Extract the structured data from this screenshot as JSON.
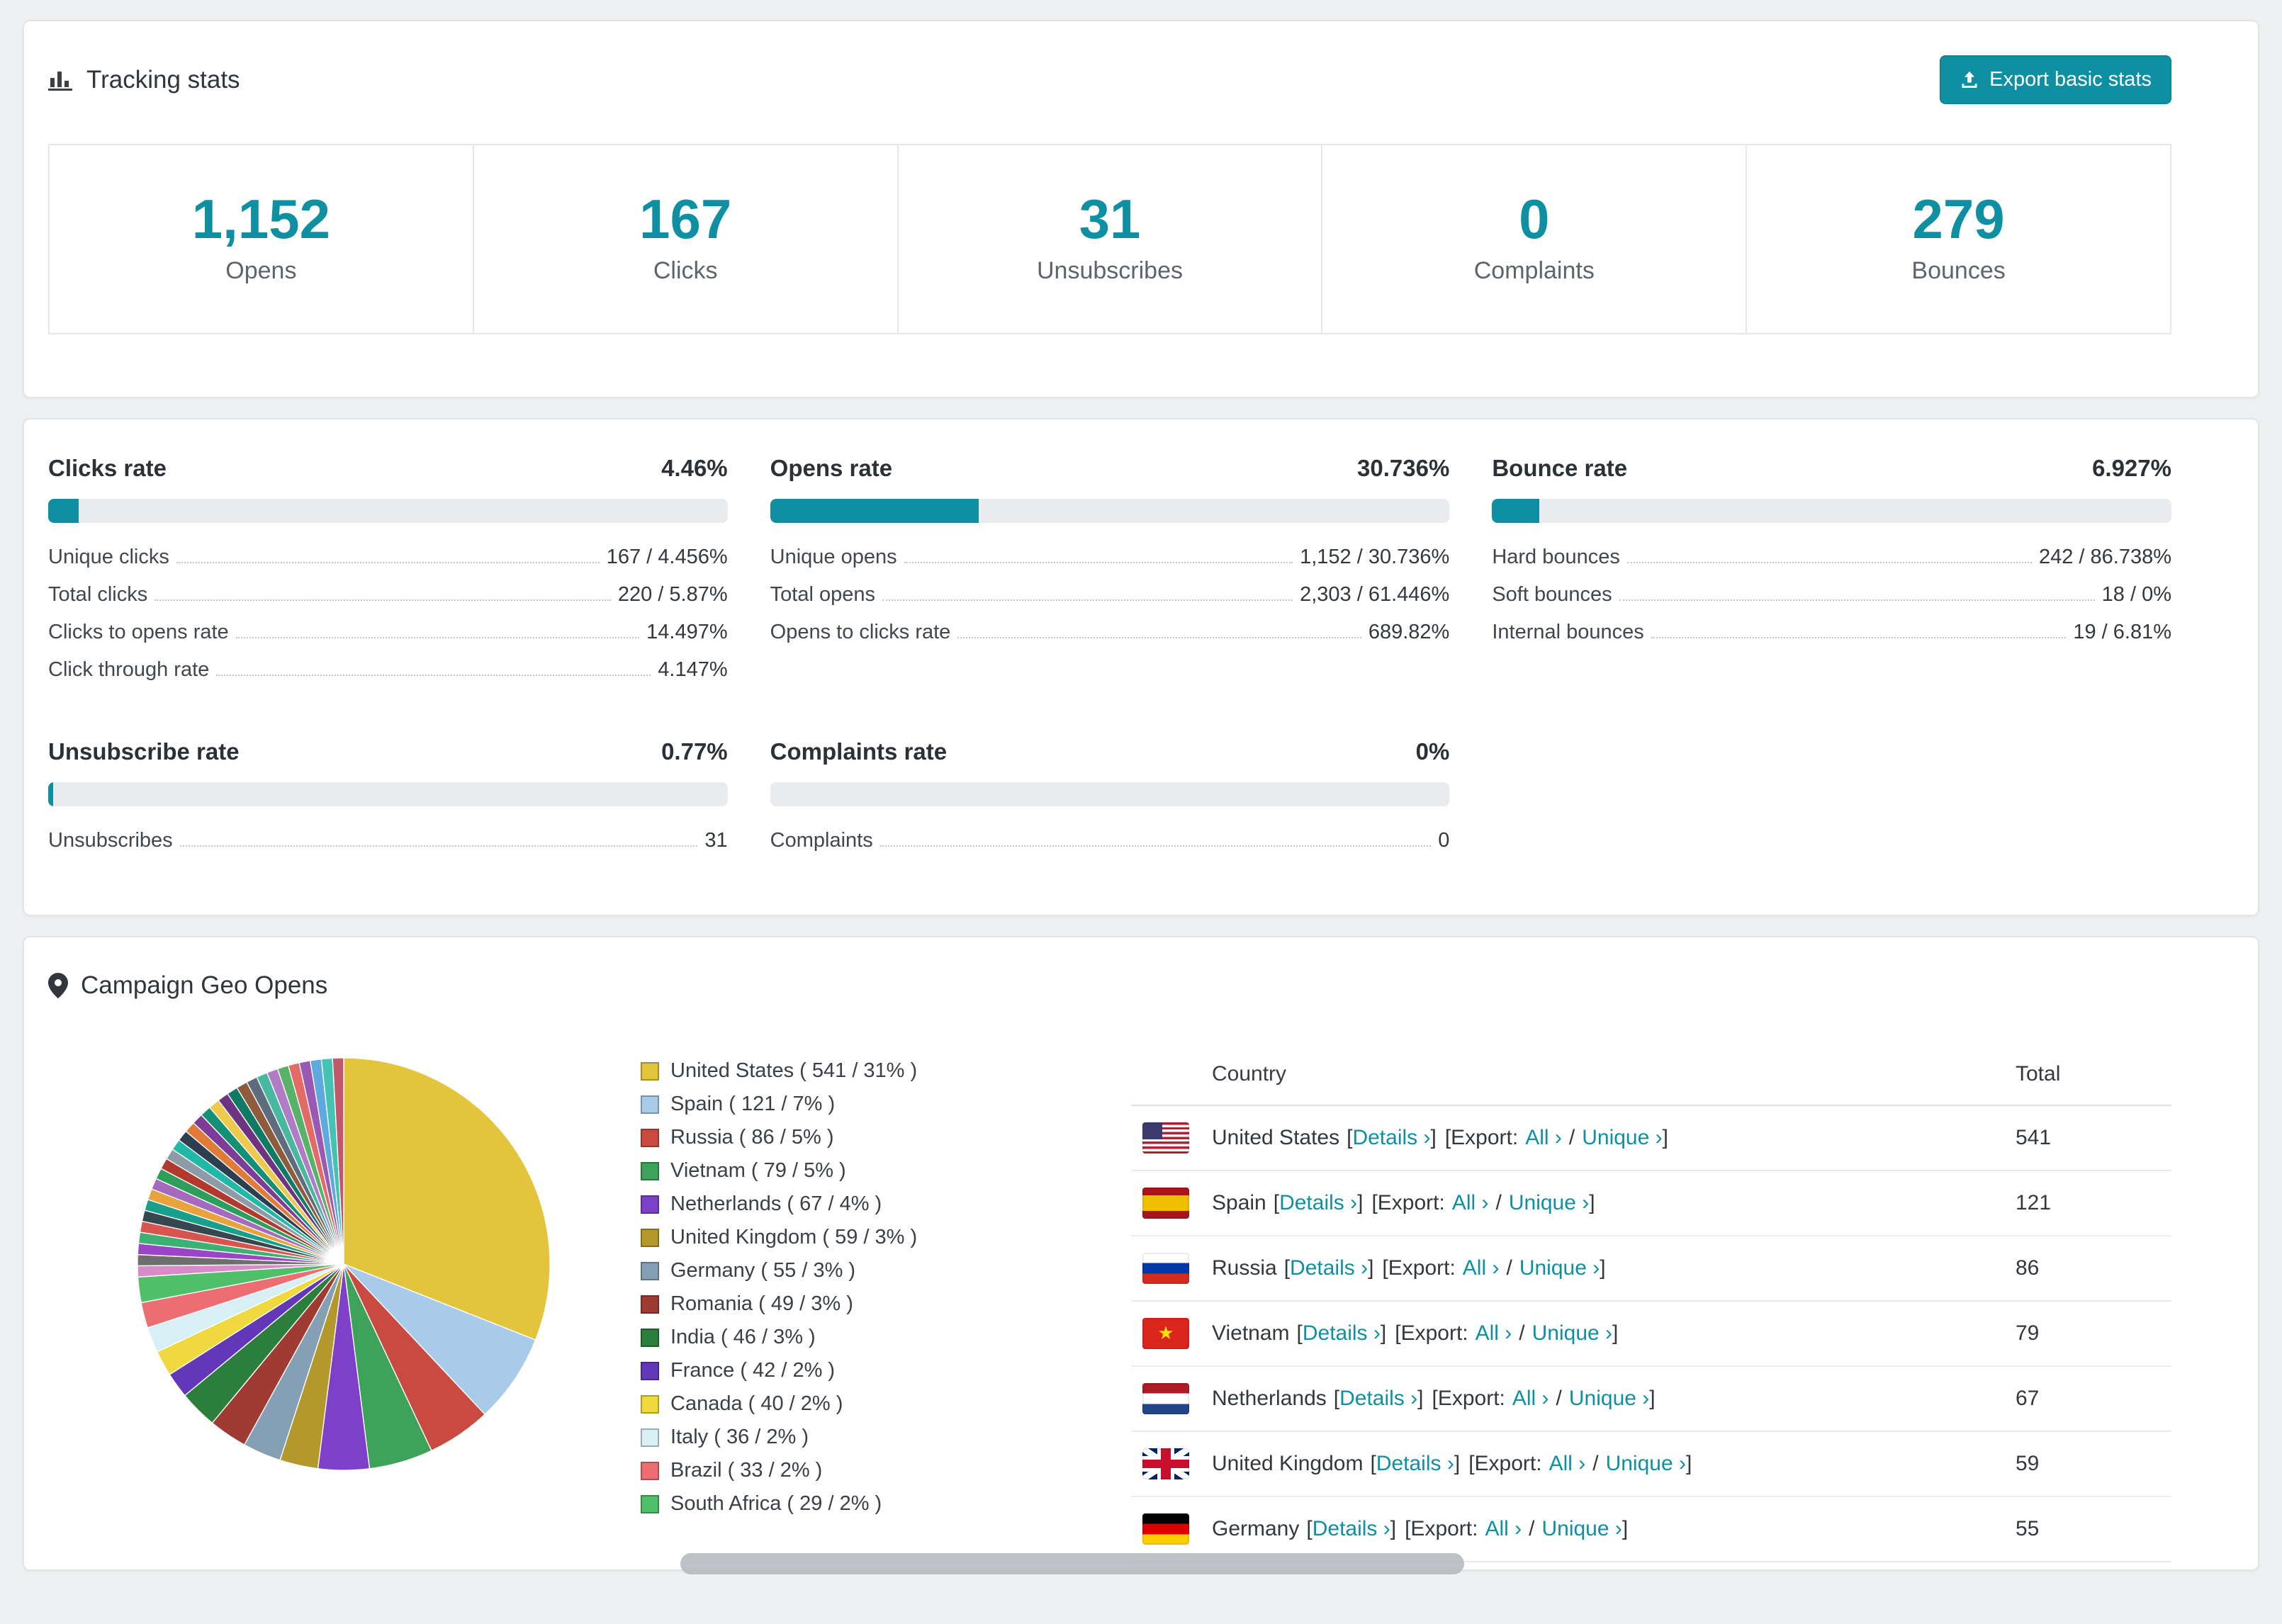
{
  "theme": {
    "accent": "#0E90A2"
  },
  "icons": {
    "header": "bar-chart-icon",
    "geo": "map-pin-icon",
    "export": "export-icon",
    "flags": [
      "us",
      "es",
      "ru",
      "vn",
      "nl",
      "gb",
      "de"
    ]
  },
  "tracking_stats": {
    "title": "Tracking stats",
    "export_button_label": "Export basic stats",
    "stats": [
      {
        "value": "1,152",
        "label": "Opens"
      },
      {
        "value": "167",
        "label": "Clicks"
      },
      {
        "value": "31",
        "label": "Unsubscribes"
      },
      {
        "value": "0",
        "label": "Complaints"
      },
      {
        "value": "279",
        "label": "Bounces"
      }
    ]
  },
  "rates": [
    {
      "title": "Clicks rate",
      "value": "4.46%",
      "percent": 4.46,
      "rows": [
        {
          "label": "Unique clicks",
          "value": "167 / 4.456%"
        },
        {
          "label": "Total clicks",
          "value": "220 / 5.87%"
        },
        {
          "label": "Clicks to opens rate",
          "value": "14.497%"
        },
        {
          "label": "Click through rate",
          "value": "4.147%"
        }
      ]
    },
    {
      "title": "Opens rate",
      "value": "30.736%",
      "percent": 30.736,
      "rows": [
        {
          "label": "Unique opens",
          "value": "1,152 / 30.736%"
        },
        {
          "label": "Total opens",
          "value": "2,303 / 61.446%"
        },
        {
          "label": "Opens to clicks rate",
          "value": "689.82%"
        }
      ]
    },
    {
      "title": "Bounce rate",
      "value": "6.927%",
      "percent": 6.927,
      "rows": [
        {
          "label": "Hard bounces",
          "value": "242 / 86.738%"
        },
        {
          "label": "Soft bounces",
          "value": "18 / 0%"
        },
        {
          "label": "Internal bounces",
          "value": "19 / 6.81%"
        }
      ]
    },
    {
      "title": "Unsubscribe rate",
      "value": "0.77%",
      "percent": 0.77,
      "rows": [
        {
          "label": "Unsubscribes",
          "value": "31"
        }
      ]
    },
    {
      "title": "Complaints rate",
      "value": "0%",
      "percent": 0,
      "rows": [
        {
          "label": "Complaints",
          "value": "0"
        }
      ]
    }
  ],
  "geo": {
    "title": "Campaign Geo Opens",
    "chart_data": {
      "type": "pie",
      "title": "Campaign Geo Opens",
      "labels": [
        "United States",
        "Spain",
        "Russia",
        "Vietnam",
        "Netherlands",
        "United Kingdom",
        "Germany",
        "Romania",
        "India",
        "France",
        "Canada",
        "Italy",
        "Brazil",
        "South Africa"
      ],
      "values": [
        541,
        121,
        86,
        79,
        67,
        59,
        55,
        49,
        46,
        42,
        40,
        36,
        33,
        29
      ],
      "percents": [
        31,
        7,
        5,
        5,
        4,
        3,
        3,
        3,
        3,
        2,
        2,
        2,
        2,
        2
      ],
      "colors": [
        "#E2C43D",
        "#A8CBEA",
        "#C94A41",
        "#3DA35A",
        "#7E3FC9",
        "#B3982C",
        "#85A0B5",
        "#A03B33",
        "#2B7E3B",
        "#6238B8",
        "#EFD93F",
        "#D7F0F6",
        "#EC6E72",
        "#4FBF68"
      ],
      "other_slices": {
        "total_percent": 26,
        "colors": [
          "#D98BC9",
          "#6E6E6E",
          "#9A45C8",
          "#3BB273",
          "#D9534F",
          "#37474F",
          "#18A08C",
          "#E8A33D",
          "#A569BD",
          "#2E9E5B",
          "#B03A2E",
          "#8D9BA6",
          "#22B8A8",
          "#2C3E50",
          "#E07B39",
          "#7D3C98",
          "#149174",
          "#EFC94C",
          "#6C3483",
          "#117A65",
          "#8E5B3C",
          "#5D6D7E",
          "#48B9A0",
          "#B07CC6",
          "#58B368",
          "#E36A66",
          "#9B59B6",
          "#5DA9E0",
          "#44C3B2",
          "#C0576B"
        ]
      },
      "legend_position": "right"
    },
    "legend": [
      {
        "label": "United States ( 541 / 31% )",
        "color": "#E2C43D"
      },
      {
        "label": "Spain ( 121 / 7% )",
        "color": "#A8CBEA"
      },
      {
        "label": "Russia ( 86 / 5% )",
        "color": "#C94A41"
      },
      {
        "label": "Vietnam ( 79 / 5% )",
        "color": "#3DA35A"
      },
      {
        "label": "Netherlands ( 67 / 4% )",
        "color": "#7E3FC9"
      },
      {
        "label": "United Kingdom ( 59 / 3% )",
        "color": "#B3982C"
      },
      {
        "label": "Germany ( 55 / 3% )",
        "color": "#85A0B5"
      },
      {
        "label": "Romania ( 49 / 3% )",
        "color": "#A03B33"
      },
      {
        "label": "India ( 46 / 3% )",
        "color": "#2B7E3B"
      },
      {
        "label": "France ( 42 / 2% )",
        "color": "#6238B8"
      },
      {
        "label": "Canada ( 40 / 2% )",
        "color": "#EFD93F"
      },
      {
        "label": "Italy ( 36 / 2% )",
        "color": "#D7F0F6"
      },
      {
        "label": "Brazil ( 33 / 2% )",
        "color": "#EC6E72"
      },
      {
        "label": "South Africa ( 29 / 2% )",
        "color": "#4FBF68"
      }
    ],
    "table": {
      "headers": {
        "country": "Country",
        "total": "Total"
      },
      "link_labels": {
        "open": "[",
        "details": "Details ›",
        "close": "]",
        "export_open": "[Export:",
        "all": "All ›",
        "slash": "/",
        "unique": "Unique ›"
      },
      "rows": [
        {
          "country": "United States",
          "flag": "us",
          "total": "541"
        },
        {
          "country": "Spain",
          "flag": "es",
          "total": "121"
        },
        {
          "country": "Russia",
          "flag": "ru",
          "total": "86"
        },
        {
          "country": "Vietnam",
          "flag": "vn",
          "total": "79"
        },
        {
          "country": "Netherlands",
          "flag": "nl",
          "total": "67"
        },
        {
          "country": "United Kingdom",
          "flag": "gb",
          "total": "59"
        },
        {
          "country": "Germany",
          "flag": "de",
          "total": "55"
        }
      ]
    }
  }
}
